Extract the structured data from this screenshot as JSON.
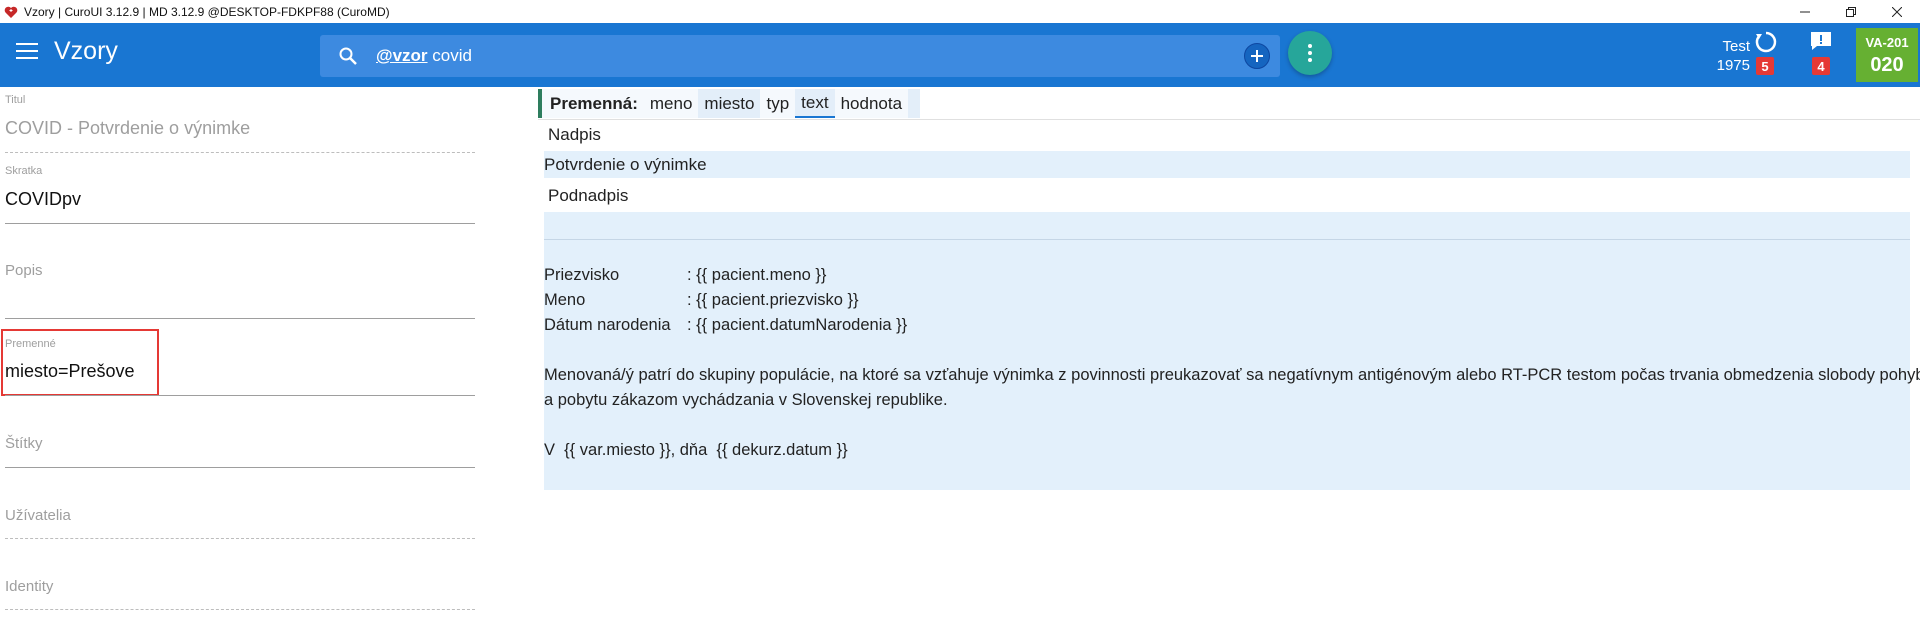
{
  "window": {
    "title": "Vzory | CuroUI 3.12.9 | MD 3.12.9 @DESKTOP-FDKPF88 (CuroMD)",
    "controls": [
      "minimize-icon",
      "restore-icon",
      "close-icon"
    ]
  },
  "appbar": {
    "title": "Vzory",
    "search_tag": "@vzor",
    "search_query": " covid",
    "user_line1": "Test",
    "user_line2": "1975",
    "sync_badge": "5",
    "msg_badge": "4",
    "room_line1": "VA-201",
    "room_line2": "020",
    "colors": {
      "appbar": "#1976d2",
      "fab": "#26a69a",
      "badge": "#e53935",
      "room": "#66b032"
    }
  },
  "form": {
    "titul": {
      "label": "Titul",
      "value": "COVID - Potvrdenie o výnimke"
    },
    "skratka": {
      "label": "Skratka",
      "value": "COVIDpv"
    },
    "popis": {
      "label": "Popis"
    },
    "premenne": {
      "label": "Premenné",
      "value": "miesto=Prešove"
    },
    "stitky": {
      "label": "Štítky"
    },
    "uzivatelia": {
      "label": "Užívatelia"
    },
    "identity": {
      "label": "Identity"
    }
  },
  "varbar": {
    "lead": "Premenná:",
    "columns": [
      "meno",
      "miesto",
      "typ",
      "text",
      "hodnota"
    ]
  },
  "editor": {
    "nadpis_label": "Nadpis",
    "nadpis_value": "Potvrdenie o výnimke",
    "podnadpis_label": "Podnadpis",
    "body": {
      "row1_key": "Priezvisko",
      "row1_val": ": {{ pacient.meno }}",
      "row2_key": "Meno",
      "row2_val": ": {{ pacient.priezvisko }}",
      "row3_key": "Dátum narodenia",
      "row3_val": ": {{ pacient.datumNarodenia }}",
      "para1": "Menovaná/ý patrí do skupiny populácie, na ktoré sa vzťahuje výnimka z povinnosti preukazovať sa negatívnym antigénovým alebo RT-PCR testom počas trvania obmedzenia slobody pohybu",
      "para2": "a pobytu zákazom vychádzania v Slovenskej republike.",
      "closing": "V  {{ var.miesto }}, dňa  {{ dekurz.datum }}"
    }
  }
}
